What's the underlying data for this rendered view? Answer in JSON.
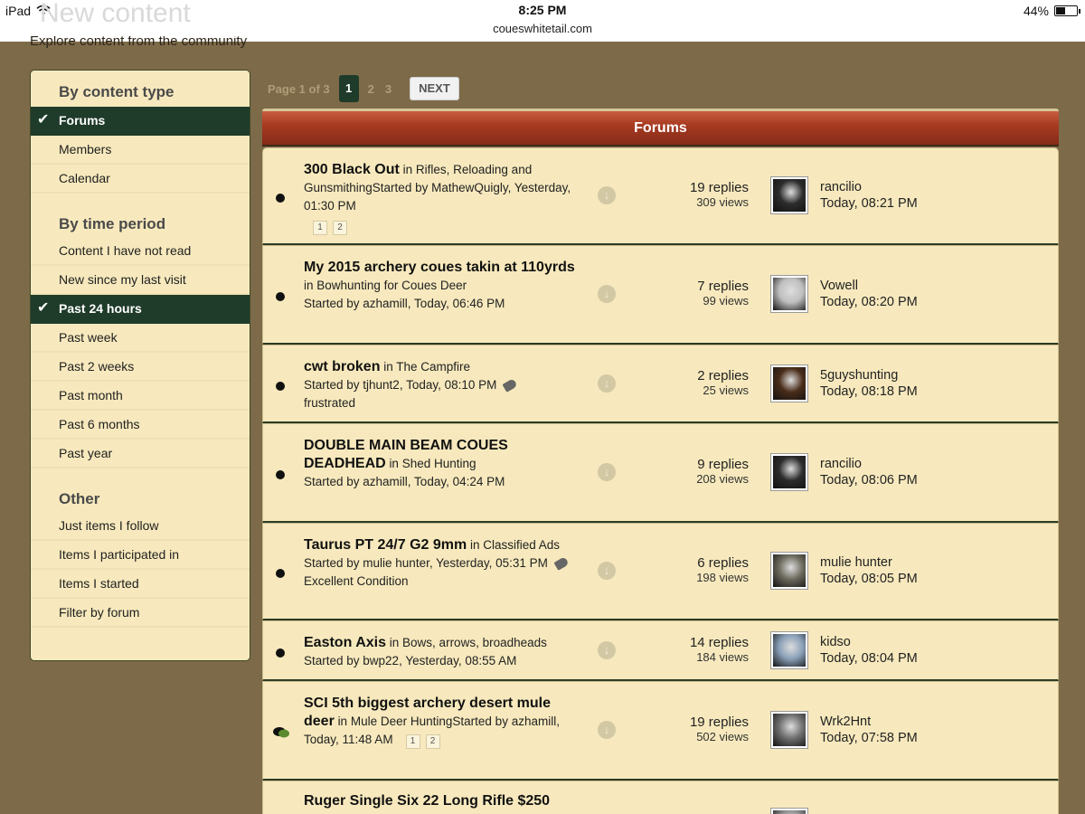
{
  "status_bar": {
    "device": "iPad",
    "time": "8:25 PM",
    "url": "coueswhitetail.com",
    "battery": "44%",
    "battery_level": 0.44
  },
  "page": {
    "title": "New content",
    "subtitle": "Explore content from the community"
  },
  "sidebar": {
    "heading_type": "By content type",
    "type_items": [
      {
        "label": "Forums",
        "active": true
      },
      {
        "label": "Members",
        "active": false
      },
      {
        "label": "Calendar",
        "active": false
      }
    ],
    "heading_time": "By time period",
    "time_items": [
      {
        "label": "Content I have not read",
        "active": false
      },
      {
        "label": "New since my last visit",
        "active": false
      },
      {
        "label": "Past 24 hours",
        "active": true
      },
      {
        "label": "Past week",
        "active": false
      },
      {
        "label": "Past 2 weeks",
        "active": false
      },
      {
        "label": "Past month",
        "active": false
      },
      {
        "label": "Past 6 months",
        "active": false
      },
      {
        "label": "Past year",
        "active": false
      }
    ],
    "heading_other": "Other",
    "other_items": [
      {
        "label": "Just items I follow"
      },
      {
        "label": "Items I participated in"
      },
      {
        "label": "Items I started"
      },
      {
        "label": "Filter by forum"
      }
    ]
  },
  "pagination": {
    "info": "Page 1 of 3",
    "pages": [
      "1",
      "2",
      "3"
    ],
    "current": "1",
    "next_label": "NEXT"
  },
  "forum_header": "Forums",
  "topics": [
    {
      "title": "300 Black Out",
      "in_label": "in",
      "forum": "Rifles, Reloading and Gunsmithing",
      "started": "Started by MathewQuigly, Yesterday, 01:30 PM",
      "tag": "",
      "pages": [
        "1",
        "2"
      ],
      "replies": "19 replies",
      "views": "309 views",
      "last_user": "rancilio",
      "last_time": "Today, 08:21 PM",
      "icon": "dot"
    },
    {
      "title": "My 2015 archery coues takin at 110yrds",
      "in_label": "in",
      "forum": "Bowhunting for Coues Deer",
      "started": "Started by azhamill, Today, 06:46 PM",
      "tag": "",
      "pages": [],
      "replies": "7 replies",
      "views": "99 views",
      "last_user": "Vowell",
      "last_time": "Today, 08:20 PM",
      "icon": "dot"
    },
    {
      "title": "cwt broken",
      "in_label": "in",
      "forum": "The Campfire",
      "started": "Started by tjhunt2, Today, 08:10 PM",
      "tag": "frustrated",
      "pages": [],
      "replies": "2 replies",
      "views": "25 views",
      "last_user": "5guyshunting",
      "last_time": "Today, 08:18 PM",
      "icon": "dot"
    },
    {
      "title": "DOUBLE MAIN BEAM COUES DEADHEAD",
      "in_label": "in",
      "forum": "Shed Hunting",
      "started": "Started by azhamill, Today, 04:24 PM",
      "tag": "",
      "pages": [],
      "replies": "9 replies",
      "views": "208 views",
      "last_user": "rancilio",
      "last_time": "Today, 08:06 PM",
      "icon": "dot"
    },
    {
      "title": "Taurus PT 24/7 G2 9mm",
      "in_label": "in",
      "forum": "Classified Ads",
      "started": "Started by mulie hunter, Yesterday, 05:31 PM",
      "tag": "Excellent Condition",
      "pages": [],
      "replies": "6 replies",
      "views": "198 views",
      "last_user": "mulie hunter",
      "last_time": "Today, 08:05 PM",
      "icon": "dot"
    },
    {
      "title": "Easton Axis",
      "in_label": "in",
      "forum": "Bows, arrows, broadheads",
      "started": "Started by bwp22, Yesterday, 08:55 AM",
      "tag": "",
      "pages": [],
      "replies": "14 replies",
      "views": "184 views",
      "last_user": "kidso",
      "last_time": "Today, 08:04 PM",
      "icon": "dot"
    },
    {
      "title": "SCI 5th biggest archery desert mule deer",
      "in_label": "in",
      "forum": "Mule Deer Hunting",
      "started": "Started by azhamill, Today, 11:48 AM",
      "tag": "",
      "pages": [
        "1",
        "2"
      ],
      "replies": "19 replies",
      "views": "502 views",
      "last_user": "Wrk2Hnt",
      "last_time": "Today, 07:58 PM",
      "icon": "bubble"
    },
    {
      "title": "Ruger Single Six 22 Long Rifle $250",
      "in_label": "",
      "forum": "",
      "started": "",
      "tag": "",
      "pages": [],
      "replies": "",
      "views": "",
      "last_user": "",
      "last_time": "",
      "icon": "none"
    }
  ]
}
